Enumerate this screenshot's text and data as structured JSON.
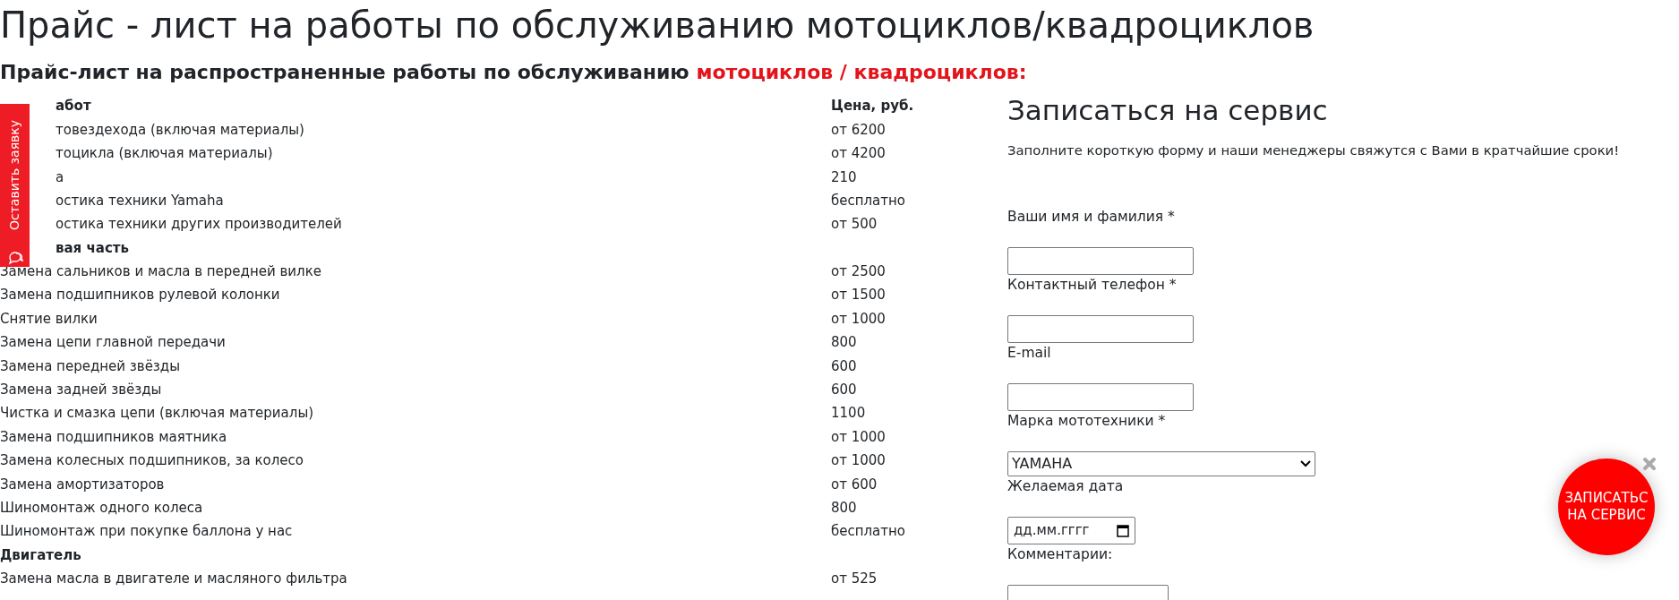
{
  "title": "Прайс - лист на работы по обслуживанию мотоциклов/квадроциклов",
  "subtitle": {
    "text": "Прайс-лист на распространенные работы по обслуживанию ",
    "highlight": "мотоциклов / квадроциклов:"
  },
  "price_table": {
    "columns": [
      {
        "label": "абот",
        "partial": true
      },
      {
        "label": "Цена, руб.",
        "partial": false
      }
    ],
    "rows": [
      {
        "kind": "item",
        "name": "товездехода (включая материалы)",
        "price": "от 6200",
        "partial": true
      },
      {
        "kind": "item",
        "name": "тоцикла (включая материалы)",
        "price": "от 4200",
        "partial": true
      },
      {
        "kind": "item",
        "name": "а",
        "price": "210",
        "partial": true
      },
      {
        "kind": "item",
        "name": "остика техники Yamaha",
        "price": "бесплатно",
        "partial": true
      },
      {
        "kind": "item",
        "name": "остика техники других производителей",
        "price": "от 500",
        "partial": true
      },
      {
        "kind": "section",
        "name": "вая часть",
        "partial": true
      },
      {
        "kind": "item",
        "name": "Замена сальников и масла в передней вилке",
        "price": "от 2500",
        "partial": false
      },
      {
        "kind": "item",
        "name": "Замена подшипников рулевой колонки",
        "price": "от 1500",
        "partial": false
      },
      {
        "kind": "item",
        "name": "Снятие вилки",
        "price": "от 1000",
        "partial": false
      },
      {
        "kind": "item",
        "name": "Замена цепи главной передачи",
        "price": "800",
        "partial": false
      },
      {
        "kind": "item",
        "name": "Замена передней звёзды",
        "price": "600",
        "partial": false
      },
      {
        "kind": "item",
        "name": "Замена задней звёзды",
        "price": "600",
        "partial": false
      },
      {
        "kind": "item",
        "name": "Чистка и смазка цепи (включая материалы)",
        "price": "1100",
        "partial": false
      },
      {
        "kind": "item",
        "name": "Замена подшипников маятника",
        "price": "от 1000",
        "partial": false
      },
      {
        "kind": "item",
        "name": "Замена колесных подшипников, за колесо",
        "price": "от 1000",
        "partial": false
      },
      {
        "kind": "item",
        "name": "Замена амортизаторов",
        "price": "от 600",
        "partial": false
      },
      {
        "kind": "item",
        "name": "Шиномонтаж одного колеса",
        "price": "800",
        "partial": false
      },
      {
        "kind": "item",
        "name": "Шиномонтаж при покупке баллона у нас",
        "price": "бесплатно",
        "partial": false
      },
      {
        "kind": "section",
        "name": "Двигатель",
        "partial": false
      },
      {
        "kind": "item",
        "name": "Замена масла в двигателе и масляного фильтра",
        "price": "от 525",
        "partial": false
      }
    ]
  },
  "side_tab": {
    "label": "Оставить заявку"
  },
  "form": {
    "title": "Записаться на сервис",
    "intro": "Заполните короткую форму и наши менеджеры свяжутся с Вами в кратчайшие сроки!",
    "fields": [
      {
        "kind": "text",
        "label": "Ваши имя и фамилия *"
      },
      {
        "kind": "text",
        "label": "Контактный телефон *"
      },
      {
        "kind": "text",
        "label": "E-mail"
      },
      {
        "kind": "select",
        "label": "Марка мототехники *",
        "value": "YAMAHA"
      },
      {
        "kind": "date",
        "label": "Желаемая дата",
        "placeholder": "дд.мм.гггг"
      },
      {
        "kind": "textarea",
        "label": "Комментарии:"
      }
    ]
  },
  "float_button": {
    "label": "ЗАПИСАТЬС НА СЕРВИС"
  }
}
